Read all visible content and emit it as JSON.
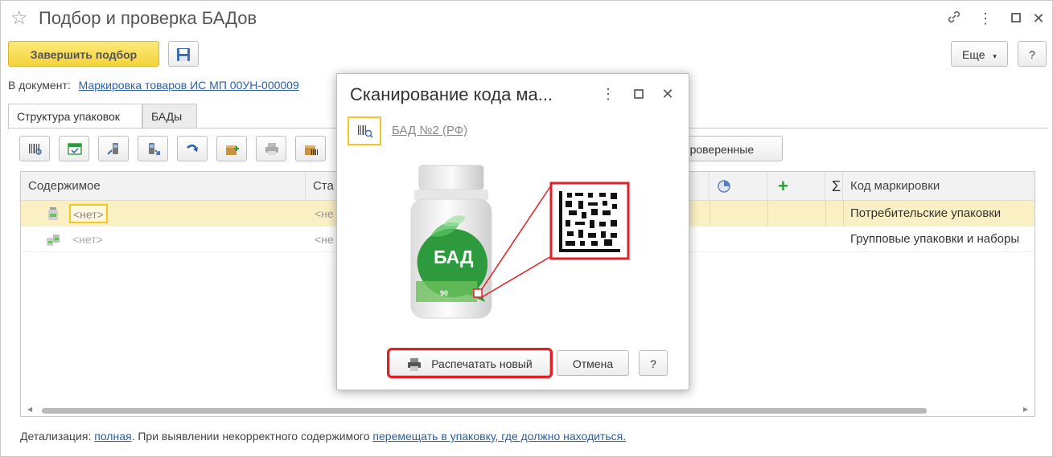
{
  "window": {
    "title": "Подбор и проверка БАДов"
  },
  "toolbar": {
    "finish_label": "Завершить подбор",
    "more_label": "Еще",
    "help_label": "?"
  },
  "document": {
    "label": "В документ:",
    "link": "Маркировка товаров ИС МП 00УН-000009"
  },
  "tabs": [
    {
      "label": "Структура упаковок",
      "active": true
    },
    {
      "label": "БАДы",
      "active": false
    }
  ],
  "checked_button_label": "проверенные",
  "table": {
    "headers": {
      "content": "Содержимое",
      "status": "Ста",
      "code": "Код маркировки"
    },
    "rows": [
      {
        "content": "<нет>",
        "status": "<не",
        "code": "Потребительские упаковки",
        "selected": true
      },
      {
        "content": "<нет>",
        "status": "<не",
        "code": "Групповые упаковки и наборы",
        "selected": false
      }
    ]
  },
  "footer": {
    "detail_label": "Детализация:",
    "detail_link": "полная",
    "text": ". При выявлении некорректного содержимого",
    "action_link": "перемещать в упаковку, где должно находиться."
  },
  "dialog": {
    "title": "Сканирование кода ма...",
    "product_link": "БАД №2 (РФ)",
    "jar_label": "БАД",
    "jar_badge": "90",
    "print_label": "Распечатать новый",
    "cancel_label": "Отмена",
    "help_label": "?"
  },
  "colors": {
    "accent_yellow": "#f4d33a",
    "link_blue": "#2c5fa8",
    "highlight_red": "#e31e24",
    "jar_green": "#2d9a3e",
    "selected_row": "#fbf0c4"
  }
}
